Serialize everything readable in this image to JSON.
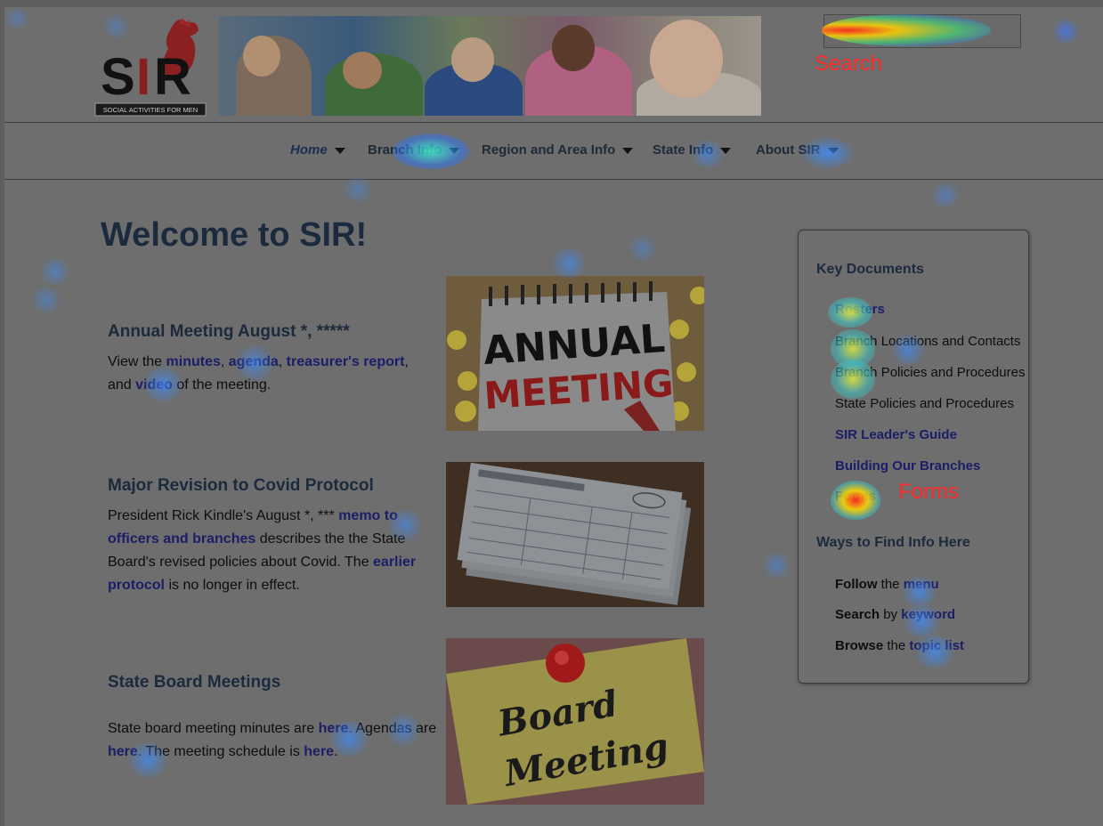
{
  "header": {
    "logo_text": "SIR",
    "logo_tagline": "SOCIAL ACTIVITIES FOR MEN",
    "search_annotation": "Search"
  },
  "nav": {
    "items": [
      {
        "label": "Home"
      },
      {
        "label": "Branch Info"
      },
      {
        "label": "Region and Area Info"
      },
      {
        "label": "State Info"
      },
      {
        "label": "About SIR"
      }
    ]
  },
  "main": {
    "title": "Welcome to SIR!",
    "stories": [
      {
        "heading": "Annual Meeting August *, *****",
        "text_parts": [
          "View the ",
          "minutes",
          ", ",
          "agenda",
          ", ",
          "treasurer's report",
          ",",
          " and ",
          "video",
          " of the meeting."
        ]
      },
      {
        "heading": "Major Revision to Covid Protocol",
        "text_parts": [
          "President Rick Kindle's August *, *** ",
          "memo to officers and branches",
          " describes the the State Board's revised policies about Covid. The ",
          "earlier protocol",
          " is no longer in effect."
        ]
      },
      {
        "heading": "State Board Meetings",
        "text_parts": [
          "State board meeting minutes are ",
          "here",
          ". Agendas are ",
          "here",
          ". The meeting schedule is ",
          "here",
          "."
        ]
      }
    ],
    "images": {
      "annual": {
        "line1": "ANNUAL",
        "line2": "MEETING"
      },
      "board": {
        "line1": "Board",
        "line2": "Meeting"
      }
    }
  },
  "sidebar": {
    "key_documents_heading": "Key Documents",
    "key_documents": [
      {
        "label": "Rosters"
      },
      {
        "label": "Branch Locations and Contacts"
      },
      {
        "label": "Branch Policies and Procedures"
      },
      {
        "label": "State Policies and Procedures"
      },
      {
        "label": "SIR Leader's Guide"
      },
      {
        "label": "Building Our Branches"
      },
      {
        "label": "Forms"
      }
    ],
    "forms_annotation": "Forms",
    "ways_heading": "Ways to Find Info Here",
    "ways": [
      {
        "bold": "Follow",
        "mid": " the ",
        "link": "menu"
      },
      {
        "bold": "Search",
        "mid": " by ",
        "link": "keyword"
      },
      {
        "bold": "Browse",
        "mid": " the ",
        "link": "topic list"
      }
    ]
  },
  "colors": {
    "heading": "#1c2a3e",
    "link": "#1b1e66",
    "annotation": "#ff2a2a",
    "overlay": "#6e6e6e"
  }
}
